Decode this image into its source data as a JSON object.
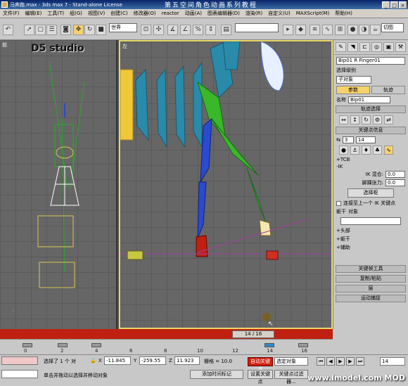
{
  "window": {
    "title": "马奔跑.max - 3ds max 7 - Stand-alone License",
    "overlay_title": "第五空间角色动画系列教程",
    "buttons": [
      "_",
      "□",
      "×"
    ]
  },
  "menu": [
    "文件(F)",
    "编辑(E)",
    "工具(T)",
    "组(G)",
    "视图(V)",
    "创建(C)",
    "修改器(O)",
    "reactor",
    "动画(A)",
    "图表编辑器(D)",
    "渲染(R)",
    "自定义(U)",
    "MAXScript(M)",
    "帮助(H)"
  ],
  "toolbar": {
    "coord_system": "世界",
    "selection_set": "",
    "named_view": "切图"
  },
  "viewports": {
    "left_label": "前",
    "right_label": "左",
    "logo": "D5 studio"
  },
  "command_panel": {
    "object_name": "Bip01 R Finger01",
    "modifier_list_label": "选择级别",
    "sub_object": "子对象",
    "tab_params": "参数",
    "tab_tracks": "轨迹",
    "name_label": "名称",
    "name_value": "Bip01",
    "rollout_track_select": "轨迹选择",
    "rollout_key_info": "关键点信息",
    "key_number": "3",
    "key_time": "14",
    "tcb_label": "+TCB",
    "ik_label": "-IK",
    "ik_blend_label": "IK 混合:",
    "ik_blend_value": "0.0",
    "ankle_tension_label": "脚踝张力:",
    "ankle_tension_value": "0.0",
    "select_pivot_button": "选择枢",
    "prev_ik_key": "连接至上一个 IK 关键点",
    "body_radio": "躯干",
    "object_radio": "对象",
    "head": "+头部",
    "hand": "+躯干",
    "fingers": "+辅助",
    "rollout_key_tools": "关键帧工具",
    "rollout_copy_paste": "复制/粘贴",
    "rollout_layers": "层",
    "rollout_motion": "运动捕捉"
  },
  "timeline": {
    "frame_display": "14 / 16",
    "ticks": [
      "0",
      "2",
      "4",
      "6",
      "8",
      "10",
      "12",
      "14",
      "16"
    ]
  },
  "status": {
    "selection": "选择了 1 个 对",
    "x_label": "X",
    "x_value": "-11.845",
    "y_label": "Y",
    "y_value": "-259.55",
    "z_label": "Z",
    "z_value": "11.923",
    "grid": "栅格 = 10.0",
    "prompt": "单击并拖动以选择并移动对象",
    "add_time_tag": "添加时间标记",
    "auto_key": "自动关键点",
    "set_key": "设置关键点",
    "selected_object": "选定对象",
    "key_filters": "关键点过滤器...",
    "frame": "14"
  },
  "watermark": "www.imodel.com MOD",
  "colors": {
    "auto_key_red": "#c02010",
    "active_yellow": "#f5d26a",
    "bone_blue": "#2a4ad0",
    "bone_green": "#3ab82a",
    "spine_teal": "#2a8aaa"
  }
}
